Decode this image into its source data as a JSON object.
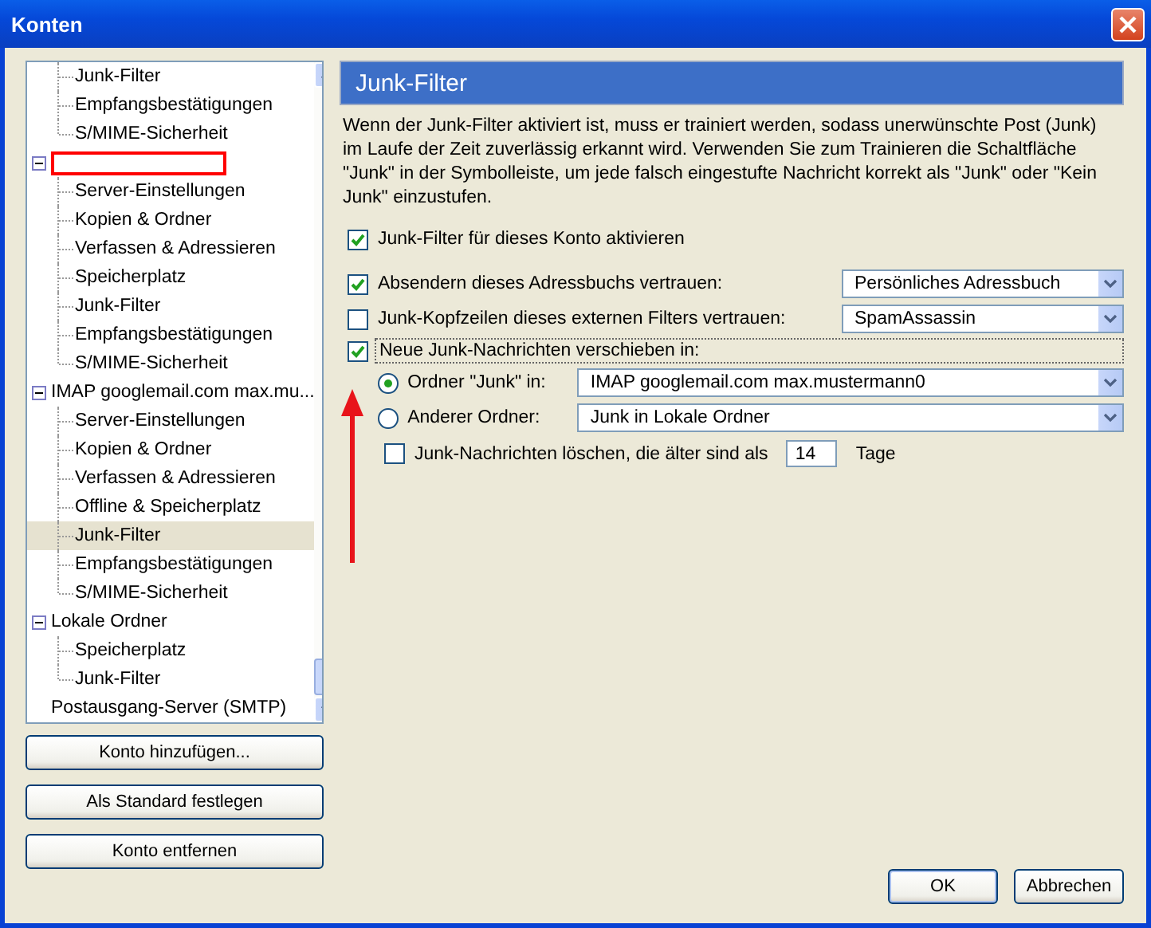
{
  "window": {
    "title": "Konten"
  },
  "tree": {
    "items": [
      {
        "children": [
          {
            "label": "Junk-Filter",
            "selected": false
          },
          {
            "label": "Empfangsbestätigungen",
            "selected": false
          },
          {
            "label": "S/MIME-Sicherheit",
            "selected": false
          }
        ]
      },
      {
        "expanded": true,
        "redacted": true,
        "children": [
          {
            "label": "Server-Einstellungen",
            "selected": false
          },
          {
            "label": "Kopien & Ordner",
            "selected": false
          },
          {
            "label": "Verfassen & Adressieren",
            "selected": false
          },
          {
            "label": "Speicherplatz",
            "selected": false
          },
          {
            "label": "Junk-Filter",
            "selected": false
          },
          {
            "label": "Empfangsbestätigungen",
            "selected": false
          },
          {
            "label": "S/MIME-Sicherheit",
            "selected": false
          }
        ]
      },
      {
        "label": "IMAP googlemail.com max.mu...",
        "expanded": true,
        "children": [
          {
            "label": "Server-Einstellungen",
            "selected": false
          },
          {
            "label": "Kopien & Ordner",
            "selected": false
          },
          {
            "label": "Verfassen & Adressieren",
            "selected": false
          },
          {
            "label": "Offline & Speicherplatz",
            "selected": false
          },
          {
            "label": "Junk-Filter",
            "selected": true
          },
          {
            "label": "Empfangsbestätigungen",
            "selected": false
          },
          {
            "label": "S/MIME-Sicherheit",
            "selected": false
          }
        ]
      },
      {
        "label": "Lokale Ordner",
        "expanded": true,
        "children": [
          {
            "label": "Speicherplatz",
            "selected": false
          },
          {
            "label": "Junk-Filter",
            "selected": false
          }
        ]
      },
      {
        "label": "Postausgang-Server (SMTP)"
      }
    ]
  },
  "account_buttons": [
    "Konto hinzufügen...",
    "Als Standard festlegen",
    "Konto entfernen"
  ],
  "panel": {
    "title": "Junk-Filter",
    "description": "Wenn der Junk-Filter aktiviert ist, muss er trainiert werden, sodass unerwünschte Post (Junk) im Laufe der Zeit zuverlässig erkannt wird. Verwenden Sie zum Trainieren die Schaltfläche \"Junk\" in der Symbolleiste, um jede falsch eingestufte Nachricht korrekt als \"Junk\" oder \"Kein Junk\" einzustufen.",
    "enable": {
      "label": "Junk-Filter für dieses Konto aktivieren",
      "checked": true
    },
    "trust": [
      {
        "label": "Absendern dieses Adressbuchs vertrauen:",
        "checked": true,
        "value": "Persönliches Adressbuch"
      },
      {
        "label": "Junk-Kopfzeilen dieses externen Filters vertrauen:",
        "checked": false,
        "value": "SpamAssassin"
      }
    ],
    "move": {
      "label": "Neue Junk-Nachrichten verschieben in:",
      "checked": true,
      "focused": true
    },
    "targets": [
      {
        "label": "Ordner \"Junk\" in:",
        "selected": true,
        "value": "IMAP googlemail.com max.mustermann0"
      },
      {
        "label": "Anderer Ordner:",
        "selected": false,
        "value": "Junk in Lokale Ordner"
      }
    ],
    "purge": {
      "label": "Junk-Nachrichten löschen, die älter sind als",
      "checked": false,
      "days": "14",
      "unit": "Tage"
    }
  },
  "buttons": [
    "OK",
    "Abbrechen"
  ]
}
